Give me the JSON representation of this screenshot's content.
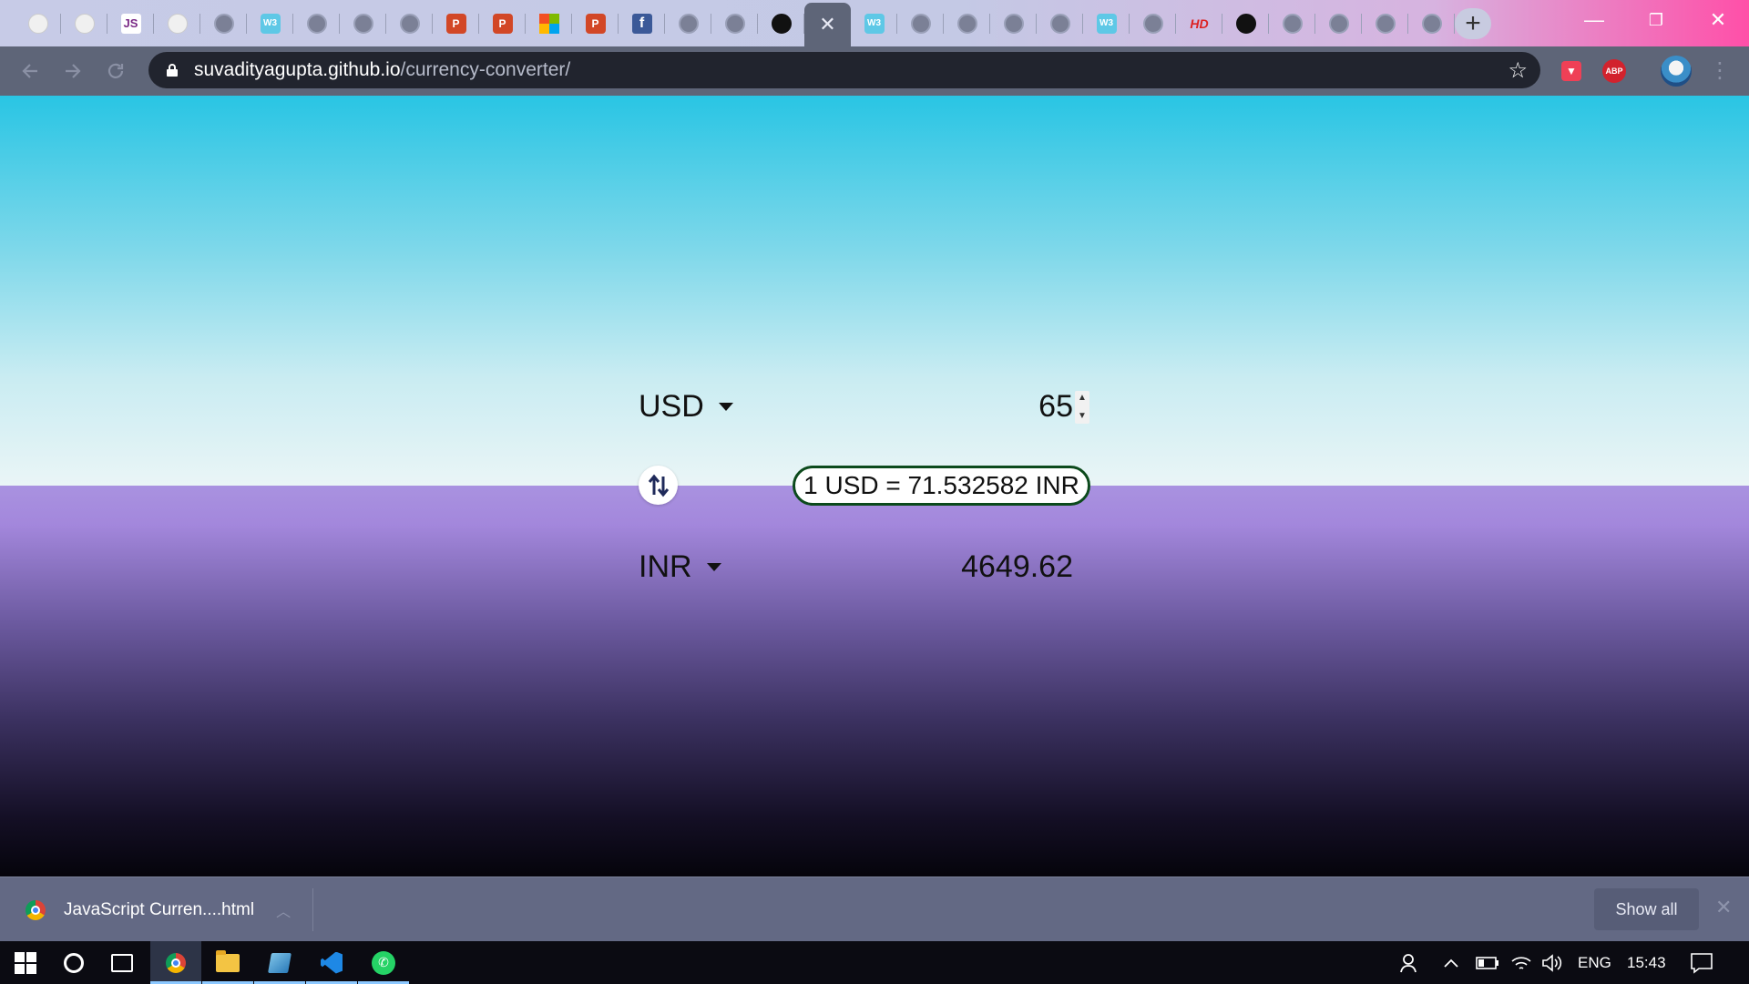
{
  "browser": {
    "tabs": [
      {
        "icon": "duck-icon"
      },
      {
        "icon": "duck-icon"
      },
      {
        "icon": "js-icon",
        "text": "JS"
      },
      {
        "icon": "duck-icon"
      },
      {
        "icon": "globe-icon"
      },
      {
        "icon": "w3schools-icon",
        "text": "W3"
      },
      {
        "icon": "globe-icon"
      },
      {
        "icon": "globe-icon"
      },
      {
        "icon": "globe-icon"
      },
      {
        "icon": "powerpoint-icon",
        "text": "P"
      },
      {
        "icon": "powerpoint-icon",
        "text": "P"
      },
      {
        "icon": "microsoft-icon"
      },
      {
        "icon": "powerpoint-icon",
        "text": "P"
      },
      {
        "icon": "facebook-icon",
        "text": "f"
      },
      {
        "icon": "globe-icon"
      },
      {
        "icon": "globe-icon"
      },
      {
        "icon": "github-icon"
      },
      {
        "icon": "active-tab-close",
        "active": true
      },
      {
        "icon": "w3schools-icon",
        "text": "W3"
      },
      {
        "icon": "globe-icon"
      },
      {
        "icon": "globe-icon"
      },
      {
        "icon": "globe-icon"
      },
      {
        "icon": "globe-icon"
      },
      {
        "icon": "w3schools-icon",
        "text": "W3"
      },
      {
        "icon": "globe-icon"
      },
      {
        "icon": "hd-icon",
        "text": "HD"
      },
      {
        "icon": "github-icon"
      },
      {
        "icon": "globe-icon"
      },
      {
        "icon": "globe-icon"
      },
      {
        "icon": "globe-icon"
      },
      {
        "icon": "globe-icon"
      }
    ],
    "new_tab_label": "+",
    "minimize_label": "—",
    "restore_label": "❐",
    "close_label": "✕",
    "url_host": "suvadityagupta.github.io",
    "url_path": "/currency-converter/",
    "extensions": [
      "pocket-icon",
      "adblock-plus-icon",
      "profile-avatar"
    ],
    "abp_text": "ABP"
  },
  "converter": {
    "from_currency": "USD",
    "from_amount": "65",
    "to_currency": "INR",
    "to_amount": "4649.62",
    "rate_text": "1 USD = 71.532582 INR"
  },
  "downloads": {
    "file_name": "JavaScript Curren....html",
    "show_all_label": "Show all"
  },
  "taskbar": {
    "language": "ENG",
    "time": "15:43"
  },
  "colors": {
    "page_top": "#29c5e4",
    "page_lower": "#a992e0",
    "rate_border": "#0c4a1c"
  }
}
